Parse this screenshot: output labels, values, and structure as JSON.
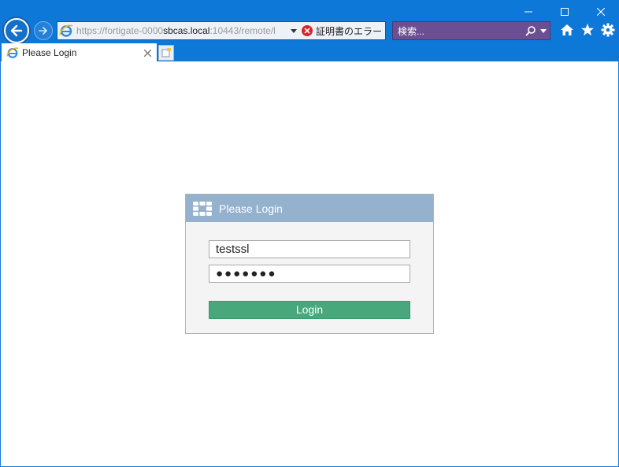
{
  "browser": {
    "address": {
      "url_prefix": "https://fortigate-0000",
      "host": "sbcas.local",
      "url_suffix": ":10443/remote/l",
      "cert_error": "証明書のエラー"
    },
    "search": {
      "placeholder": "検索..."
    },
    "tab": {
      "title": "Please Login"
    },
    "colors": {
      "chrome": "#0d78d7",
      "search_bg": "#6c4f93"
    }
  },
  "login": {
    "header_title": "Please Login",
    "username_value": "testssl",
    "password_value": "●●●●●●●",
    "button_label": "Login",
    "colors": {
      "header": "#94b1cd",
      "button": "#47a87c",
      "panel": "#f4f4f4"
    }
  }
}
